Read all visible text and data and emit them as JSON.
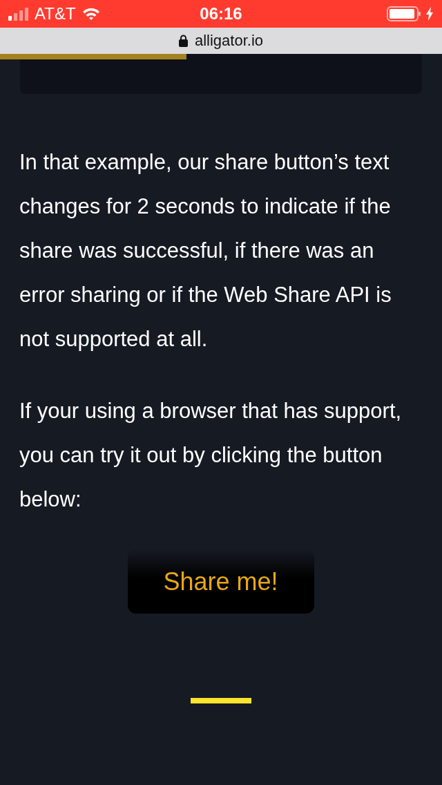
{
  "status_bar": {
    "carrier": "AT&T",
    "time": "06:16"
  },
  "address_bar": {
    "url": "alligator.io"
  },
  "paragraphs": [
    "In that example, our share button’s text changes for 2 seconds to indicate if the share was successful, if there was an error sharing or if the Web Share API is not supported at all.",
    "If your using a browser that has support, you can try it out by clicking the button below:"
  ],
  "button": {
    "label": "Share me!"
  }
}
